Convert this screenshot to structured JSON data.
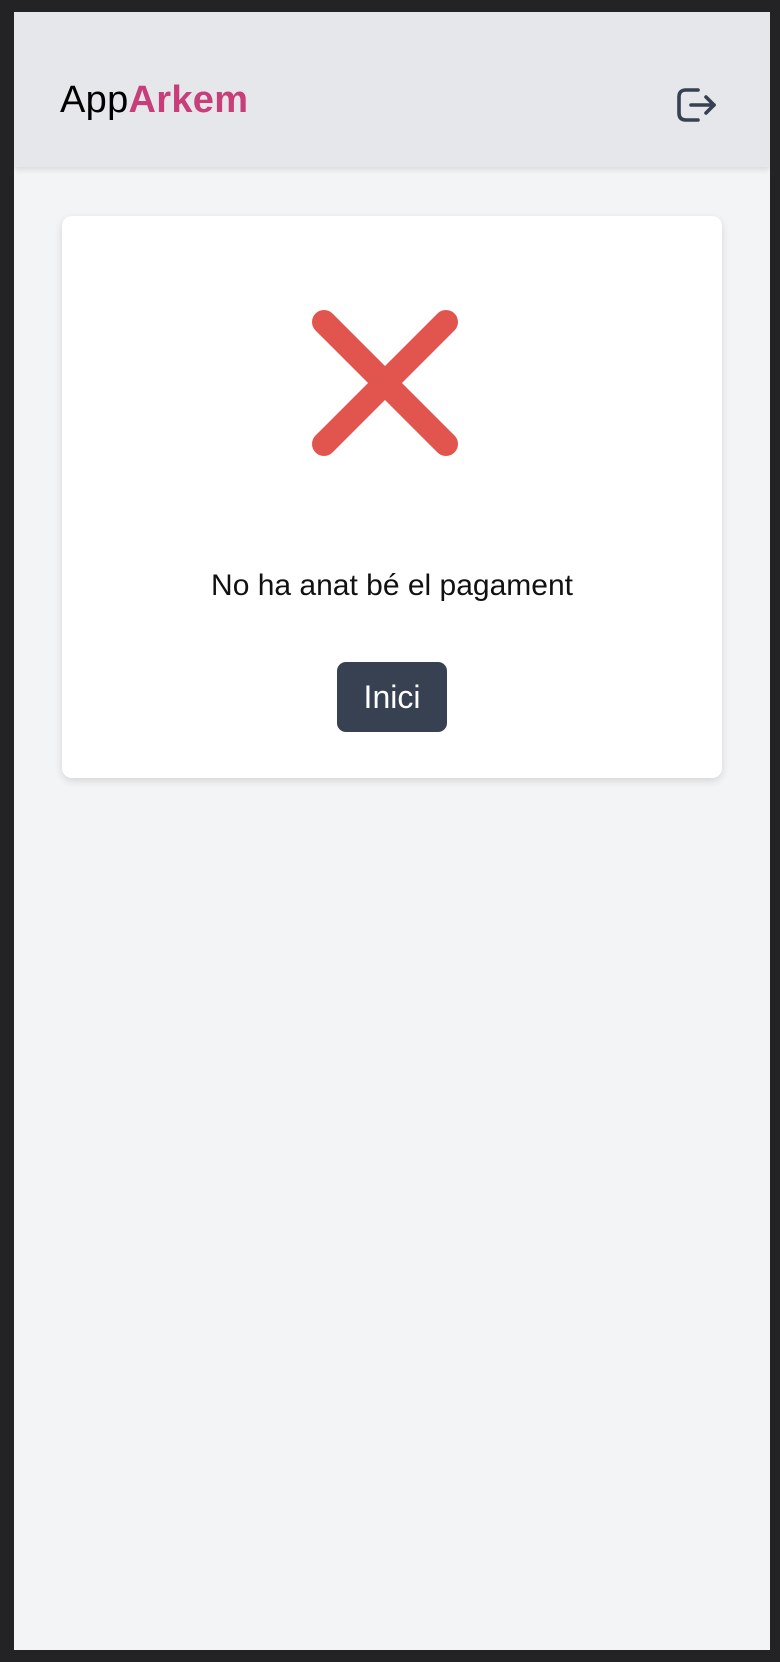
{
  "header": {
    "brand_prefix": "App",
    "brand_accent": "Arkem",
    "logout_icon": "logout-icon"
  },
  "result": {
    "status_icon": "close-x-icon",
    "message": "No ha anat bé el pagament",
    "home_button_label": "Inici"
  },
  "colors": {
    "accent": "#c73e78",
    "error": "#e2554f",
    "button": "#374151",
    "header_bg": "#e5e7eb",
    "page_bg": "#f3f4f5"
  }
}
